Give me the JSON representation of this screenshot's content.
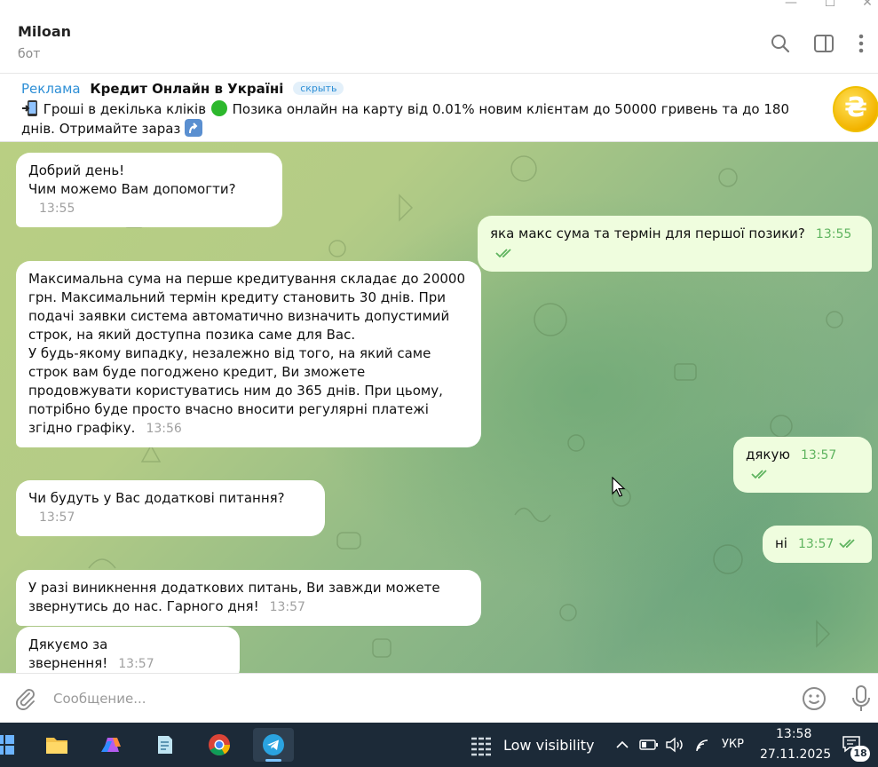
{
  "chat": {
    "title": "Miloan",
    "subtitle": "бот"
  },
  "ad": {
    "label": "Реклама",
    "title": "Кредит Онлайн в Україні",
    "hide_label": "скрыть",
    "body_part1": "Гроші в декілька кліків",
    "body_part2": "Позика онлайн на карту від 0.01% новим клієнтам до 50000 гривень та до 180 днів. Отримайте зараз"
  },
  "messages": [
    {
      "direction": "in",
      "text": "Добрий день!\nЧим можемо Вам допомогти?",
      "time": "13:55"
    },
    {
      "direction": "out",
      "text": "яка макс сума та термін для першої позики?",
      "time": "13:55",
      "status": "read"
    },
    {
      "direction": "in",
      "text": "Максимальна сума на перше кредитування складає до 20000 грн. Максимальний термін кредиту становить 30 днів. При подачі заявки система автоматично визначить допустимий строк, на який доступна позика саме для Вас.\nУ будь-якому випадку, незалежно від того, на який саме строк вам буде погоджено кредит, Ви зможете продовжувати користуватись ним до 365 днів. При цьому, потрібно буде просто вчасно вносити регулярні платежі згідно графіку.",
      "time": "13:56"
    },
    {
      "direction": "out",
      "text": "дякую",
      "time": "13:57",
      "status": "read"
    },
    {
      "direction": "in",
      "text": "Чи будуть у Вас додаткові питання?",
      "time": "13:57"
    },
    {
      "direction": "out",
      "text": "ні",
      "time": "13:57",
      "status": "read"
    },
    {
      "direction": "in",
      "text": "У разі виникнення додаткових питань, Ви завжди можете звернутись до нас. Гарного дня!",
      "time": "13:57"
    },
    {
      "direction": "in",
      "text": "Дякуємо за звернення!",
      "time": "13:57"
    }
  ],
  "composer": {
    "placeholder": "Сообщение..."
  },
  "taskbar": {
    "apps": [
      "file-explorer",
      "copilot",
      "notepad",
      "chrome",
      "telegram"
    ],
    "weather": "Low visibility",
    "language": "УКР",
    "time": "13:58",
    "date": "27.11.2025",
    "notification_count": "18"
  },
  "colors": {
    "accent": "#2e8fd6",
    "incoming_bubble": "#ffffff",
    "outgoing_bubble": "#effdde",
    "read_tick": "#5fb45f",
    "taskbar": "#1c2a38"
  }
}
